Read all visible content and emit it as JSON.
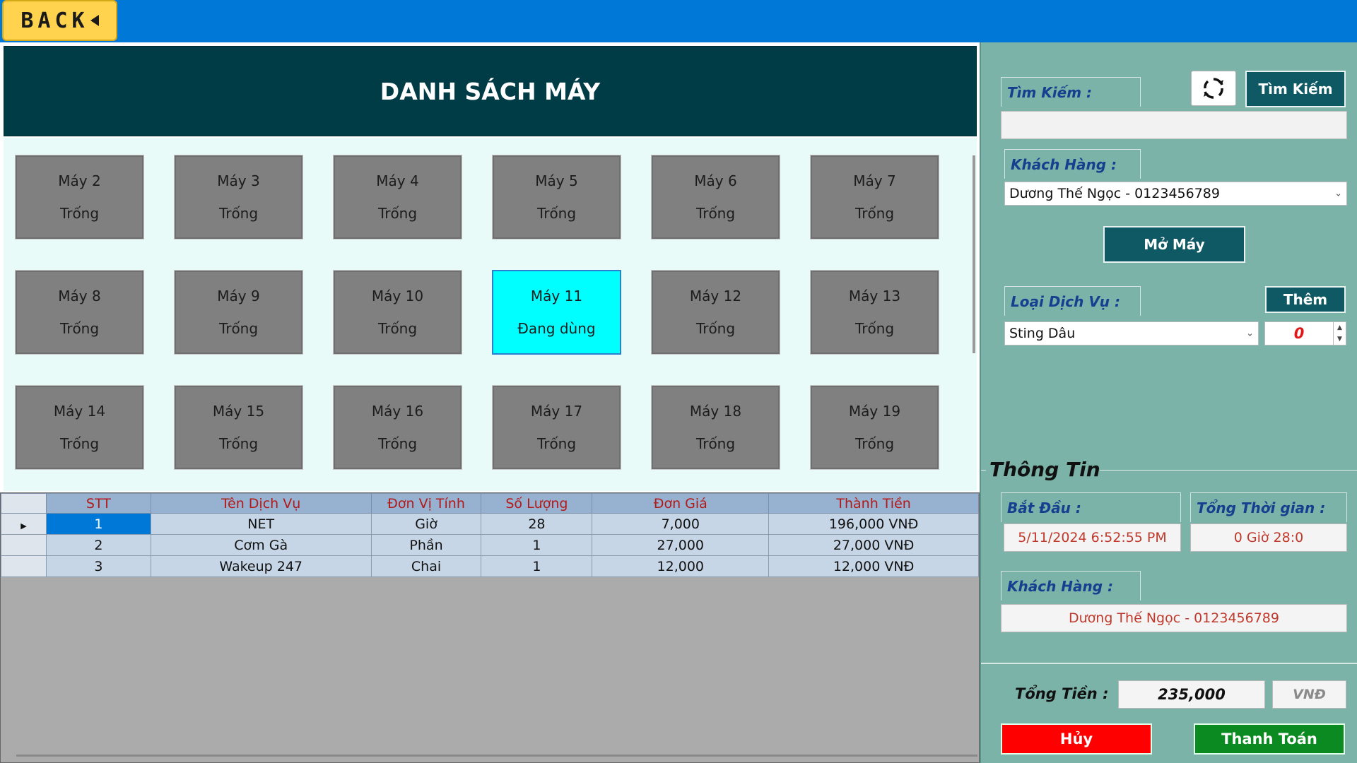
{
  "topbar": {
    "back_label": "BACK"
  },
  "header": {
    "title": "DANH SÁCH MÁY"
  },
  "machines": [
    {
      "name": "Máy 2",
      "status": "Trống"
    },
    {
      "name": "Máy 3",
      "status": "Trống"
    },
    {
      "name": "Máy 4",
      "status": "Trống"
    },
    {
      "name": "Máy 5",
      "status": "Trống"
    },
    {
      "name": "Máy 6",
      "status": "Trống"
    },
    {
      "name": "Máy 7",
      "status": "Trống"
    },
    {
      "name": "Máy 8",
      "status": "Trống"
    },
    {
      "name": "Máy 9",
      "status": "Trống"
    },
    {
      "name": "Máy 10",
      "status": "Trống"
    },
    {
      "name": "Máy 11",
      "status": "Đang dùng"
    },
    {
      "name": "Máy 12",
      "status": "Trống"
    },
    {
      "name": "Máy 13",
      "status": "Trống"
    },
    {
      "name": "Máy 14",
      "status": "Trống"
    },
    {
      "name": "Máy 15",
      "status": "Trống"
    },
    {
      "name": "Máy 16",
      "status": "Trống"
    },
    {
      "name": "Máy 17",
      "status": "Trống"
    },
    {
      "name": "Máy 18",
      "status": "Trống"
    },
    {
      "name": "Máy 19",
      "status": "Trống"
    }
  ],
  "table": {
    "headers": [
      "STT",
      "Tên Dịch Vụ",
      "Đơn Vị Tính",
      "Số Lượng",
      "Đơn Giá",
      "Thành Tiền"
    ],
    "rows": [
      [
        "1",
        "NET",
        "Giờ",
        "28",
        "7,000",
        "196,000 VNĐ"
      ],
      [
        "2",
        "Cơm Gà",
        "Phần",
        "1",
        "27,000",
        "27,000 VNĐ"
      ],
      [
        "3",
        "Wakeup 247",
        "Chai",
        "1",
        "12,000",
        "12,000 VNĐ"
      ]
    ]
  },
  "right": {
    "search_label": "Tìm Kiếm :",
    "search_button": "Tìm Kiếm",
    "search_value": "",
    "customer_label": "Khách Hàng :",
    "customer_value": "Dương Thế Ngọc - 0123456789",
    "open_button": "Mở Máy",
    "service_label": "Loại Dịch Vụ :",
    "add_button": "Thêm",
    "service_value": "Sting Dâu",
    "quantity": "0",
    "info_title": "Thông Tin",
    "start_label": "Bắt Đầu :",
    "start_value": "5/11/2024 6:52:55 PM",
    "duration_label": "Tổng Thời gian :",
    "duration_value": "0 Giờ 28:0",
    "info_customer_label": "Khách Hàng :",
    "info_customer_value": "Dương Thế Ngọc - 0123456789",
    "total_label": "Tổng Tiền :",
    "total_value": "235,000",
    "currency": "VNĐ",
    "cancel_button": "Hủy",
    "pay_button": "Thanh Toán"
  },
  "colors": {
    "topbar": "#0078d7",
    "header": "#003c46",
    "machine_idle": "#808080",
    "machine_active": "#00ffff",
    "panel": "#7bb3a8",
    "cancel": "#ff0000",
    "pay": "#0c8a22"
  },
  "icons": {
    "back": "back-triangle-icon",
    "refresh": "refresh-icon"
  }
}
